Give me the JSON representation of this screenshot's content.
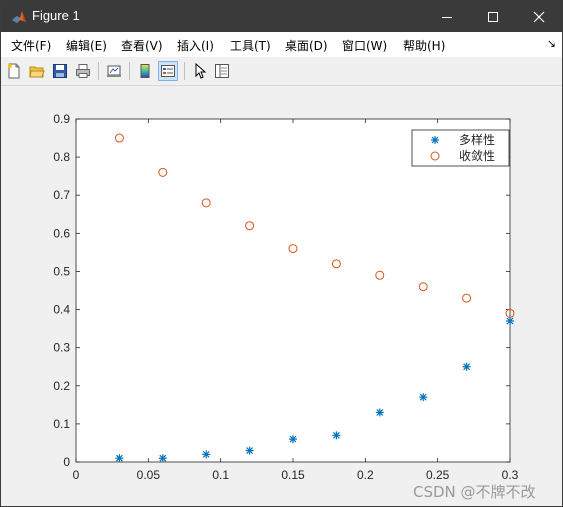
{
  "window": {
    "title": "Figure 1"
  },
  "menubar": {
    "items": [
      {
        "label": "文件(F)"
      },
      {
        "label": "编辑(E)"
      },
      {
        "label": "查看(V)"
      },
      {
        "label": "插入(I)"
      },
      {
        "label": "工具(T)"
      },
      {
        "label": "桌面(D)"
      },
      {
        "label": "窗口(W)"
      },
      {
        "label": "帮助(H)"
      }
    ],
    "overflow_arrow": "↘"
  },
  "toolbar": {
    "icons": [
      "new-figure-icon",
      "open-file-icon",
      "save-icon",
      "print-icon",
      "link-plot-icon",
      "insert-colorbar-icon",
      "insert-legend-icon",
      "edit-plot-arrow-icon",
      "property-inspector-icon"
    ]
  },
  "watermark": "CSDN @不牌不改",
  "chart_data": {
    "type": "scatter",
    "title": "",
    "xlabel": "",
    "ylabel": "",
    "xlim": [
      0,
      0.3
    ],
    "ylim": [
      0,
      0.9
    ],
    "x_ticks": [
      "0",
      "0.05",
      "0.1",
      "0.15",
      "0.2",
      "0.25",
      "0.3"
    ],
    "y_ticks": [
      "0",
      "0.1",
      "0.2",
      "0.3",
      "0.4",
      "0.5",
      "0.6",
      "0.7",
      "0.8",
      "0.9"
    ],
    "legend_position": "top-right",
    "series": [
      {
        "name": "多样性",
        "marker": "asterisk",
        "color": "#0072bd",
        "x": [
          0.03,
          0.06,
          0.09,
          0.12,
          0.15,
          0.18,
          0.21,
          0.24,
          0.27,
          0.3
        ],
        "y": [
          0.01,
          0.01,
          0.02,
          0.03,
          0.06,
          0.07,
          0.13,
          0.17,
          0.25,
          0.37
        ]
      },
      {
        "name": "收敛性",
        "marker": "circle",
        "color": "#d95319",
        "x": [
          0.03,
          0.06,
          0.09,
          0.12,
          0.15,
          0.18,
          0.21,
          0.24,
          0.27,
          0.3
        ],
        "y": [
          0.85,
          0.76,
          0.68,
          0.62,
          0.56,
          0.52,
          0.49,
          0.46,
          0.43,
          0.39
        ]
      }
    ]
  }
}
